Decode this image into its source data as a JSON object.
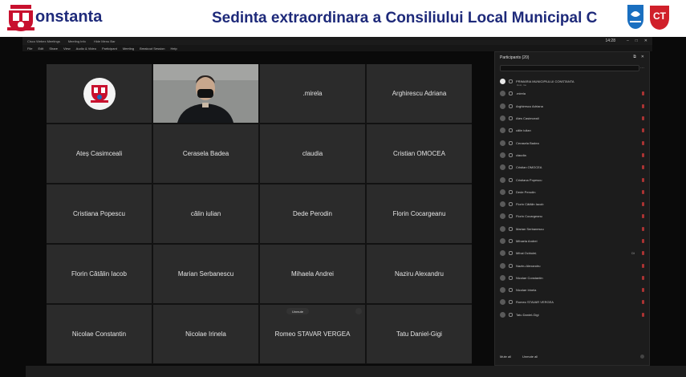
{
  "banner": {
    "city": "onstanta",
    "title": "Sedinta extraordinara a Consiliului Local Municipal C",
    "badge": "CT",
    "colors": {
      "title": "#1e2a7a",
      "badge": "#d0202a",
      "shield": "#1a6fc0"
    }
  },
  "titlebar": {
    "items": [
      "Cisco Webex Meetings",
      "Meeting Info",
      "Hide Menu Bar"
    ],
    "clock": "14:28"
  },
  "menubar": {
    "items": [
      "File",
      "Edit",
      "Share",
      "View",
      "Audio & Video",
      "Participant",
      "Meeting",
      "Breakout Session",
      "Help"
    ]
  },
  "grid": {
    "tiles": [
      {
        "name": "",
        "type": "logo"
      },
      {
        "name": "",
        "type": "video"
      },
      {
        "name": ".mirela"
      },
      {
        "name": "Arghirescu Adriana"
      },
      {
        "name": "Ateș Casimceali"
      },
      {
        "name": "Cerasela Badea"
      },
      {
        "name": "claudia"
      },
      {
        "name": "Cristian OMOCEA"
      },
      {
        "name": "Cristiana Popescu"
      },
      {
        "name": "călin iulian"
      },
      {
        "name": "Dede Perodin"
      },
      {
        "name": "Florin Cocargeanu"
      },
      {
        "name": "Florin Cătălin Iacob"
      },
      {
        "name": "Marian Serbanescu"
      },
      {
        "name": "Mihaela Andrei"
      },
      {
        "name": "Naziru Alexandru"
      },
      {
        "name": "Nicolae Constantin"
      },
      {
        "name": "Nicolae Irinela"
      },
      {
        "name": "Romeo STAVAR VERGEA"
      },
      {
        "name": "Tatu Daniel-Gigi"
      }
    ],
    "unmute_label": "Unmute"
  },
  "panel": {
    "title": "Participants (20)",
    "participants": [
      {
        "name": "PRIMARIA MUNICIPIULUI CONSTANTA",
        "sub": "Host, me",
        "logo": true
      },
      {
        "name": ".mirela"
      },
      {
        "name": "Arghirescu Adriana"
      },
      {
        "name": "Ates Casimceali"
      },
      {
        "name": "călin iulian"
      },
      {
        "name": "Cerasela Badea"
      },
      {
        "name": "claudia"
      },
      {
        "name": "Cristian OMOCEA"
      },
      {
        "name": "Cristiana Popescu"
      },
      {
        "name": "Dede Perodin"
      },
      {
        "name": "Florin Cătălin Iacob"
      },
      {
        "name": "Florin Cocargeanu"
      },
      {
        "name": "Marian Serbanescu"
      },
      {
        "name": "Mihaela Andrei"
      },
      {
        "name": "Mihai Ochiuleț",
        "role": "Cit"
      },
      {
        "name": "Naziru Alexandru"
      },
      {
        "name": "Nicolae Constantin"
      },
      {
        "name": "Nicolae Irinela"
      },
      {
        "name": "Romeo STAVAR VERGEA"
      },
      {
        "name": "Tatu Daniel-Gigi"
      }
    ],
    "footer": {
      "mute_all": "Mute all",
      "unmute_all": "Unmute all"
    }
  }
}
